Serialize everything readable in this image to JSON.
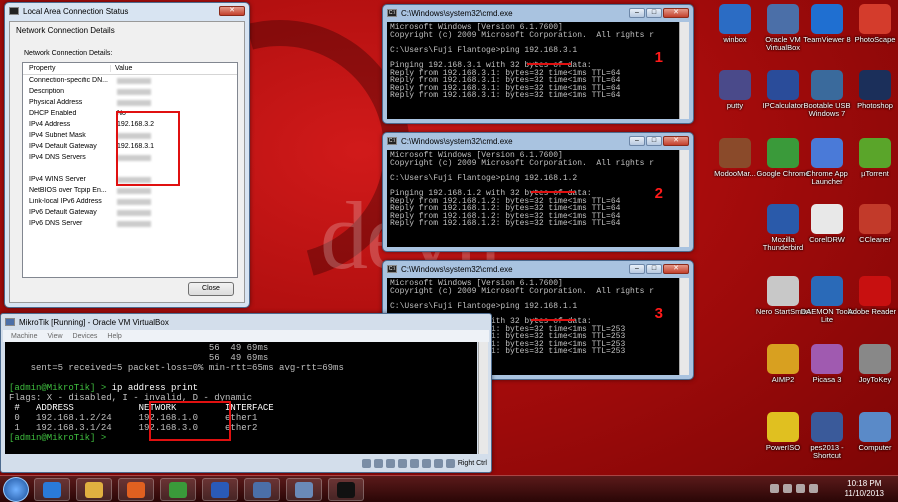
{
  "net_dialog": {
    "title": "Local Area Connection Status",
    "tab": "Network Connection Details",
    "group_label": "Network Connection Details:",
    "col_property": "Property",
    "col_value": "Value",
    "rows": [
      {
        "p": "Connection-specific DN...",
        "v": ""
      },
      {
        "p": "Description",
        "v": ""
      },
      {
        "p": "Physical Address",
        "v": ""
      },
      {
        "p": "DHCP Enabled",
        "v": "No"
      },
      {
        "p": "IPv4 Address",
        "v": "192.168.3.2"
      },
      {
        "p": "IPv4 Subnet Mask",
        "v": ""
      },
      {
        "p": "IPv4 Default Gateway",
        "v": "192.168.3.1"
      },
      {
        "p": "IPv4 DNS Servers",
        "v": ""
      },
      {
        "p": "",
        "v": ""
      },
      {
        "p": "IPv4 WINS Server",
        "v": ""
      },
      {
        "p": "NetBIOS over Tcpip En...",
        "v": ""
      },
      {
        "p": "Link-local IPv6 Address",
        "v": ""
      },
      {
        "p": "IPv6 Default Gateway",
        "v": ""
      },
      {
        "p": "IPv6 DNS Server",
        "v": ""
      }
    ],
    "close_label": "Close"
  },
  "cmd_windows": [
    {
      "title": "C:\\Windows\\system32\\cmd.exe",
      "number": "1",
      "lines": [
        "Microsoft Windows [Version 6.1.7600]",
        "Copyright (c) 2009 Microsoft Corporation.  All rights r",
        "",
        "C:\\Users\\Fuji Flantoge>ping 192.168.3.1",
        "",
        "Pinging 192.168.3.1 with 32 bytes of data:",
        "Reply from 192.168.3.1: bytes=32 time<1ms TTL=64",
        "Reply from 192.168.3.1: bytes=32 time<1ms TTL=64",
        "Reply from 192.168.3.1: bytes=32 time<1ms TTL=64",
        "Reply from 192.168.3.1: bytes=32 time<1ms TTL=64"
      ]
    },
    {
      "title": "C:\\Windows\\system32\\cmd.exe",
      "number": "2",
      "lines": [
        "Microsoft Windows [Version 6.1.7600]",
        "Copyright (c) 2009 Microsoft Corporation.  All rights r",
        "",
        "C:\\Users\\Fuji Flantoge>ping 192.168.1.2",
        "",
        "Pinging 192.168.1.2 with 32 bytes of data:",
        "Reply from 192.168.1.2: bytes=32 time<1ms TTL=64",
        "Reply from 192.168.1.2: bytes=32 time<1ms TTL=64",
        "Reply from 192.168.1.2: bytes=32 time<1ms TTL=64",
        "Reply from 192.168.1.2: bytes=32 time<1ms TTL=64"
      ]
    },
    {
      "title": "C:\\Windows\\system32\\cmd.exe",
      "number": "3",
      "lines": [
        "Microsoft Windows [Version 6.1.7600]",
        "Copyright (c) 2009 Microsoft Corporation.  All rights r",
        "",
        "C:\\Users\\Fuji Flantoge>ping 192.168.1.1",
        "",
        "Pinging 192.168.1.1 with 32 bytes of data:",
        "Reply from 192.168.1.1: bytes=32 time<1ms TTL=253",
        "Reply from 192.168.1.1: bytes=32 time<1ms TTL=253",
        "Reply from 192.168.1.1: bytes=32 time<1ms TTL=253",
        "Reply from 192.168.1.1: bytes=32 time<1ms TTL=253"
      ]
    }
  ],
  "vbox": {
    "title": "MikroTik [Running] - Oracle VM VirtualBox",
    "menu": [
      "Machine",
      "View",
      "Devices",
      "Help"
    ],
    "line1": "                                     56  49 69ms",
    "line2": "                                     56  49 69ms",
    "line3": "    sent=5 received=5 packet-loss=0% min-rtt=65ms avg-rtt=69ms",
    "prompt": "[admin@MikroTik] > ",
    "cmd": "ip address print",
    "flags": "Flags: X - disabled, I - invalid, D - dynamic",
    "header": " #   ADDRESS            NETWORK         INTERFACE",
    "row0": " 0   192.168.1.2/24     192.168.1.0     ether1",
    "row1": " 1   192.168.3.1/24     192.168.3.0     ether2",
    "status_key": "Right Ctrl"
  },
  "desktop_icons": [
    {
      "label": "winbox",
      "color": "#2b6cc4"
    },
    {
      "label": "Oracle VM VirtualBox",
      "color": "#4b6fa8"
    },
    {
      "label": "TeamViewer 8",
      "color": "#1f6fd1"
    },
    {
      "label": "PhotoScape",
      "color": "#d43c2c"
    },
    {
      "label": "putty",
      "color": "#4a4a8a"
    },
    {
      "label": "IPCalculator",
      "color": "#2a4c9a"
    },
    {
      "label": "Bootable USB Windows 7",
      "color": "#3a6a9c"
    },
    {
      "label": "Photoshop",
      "color": "#1b2f5a"
    },
    {
      "label": "ModooMar...",
      "color": "#8a4a2a"
    },
    {
      "label": "Google Chrome",
      "color": "#3a9a3a"
    },
    {
      "label": "Chrome App Launcher",
      "color": "#4a7ad8"
    },
    {
      "label": "µTorrent",
      "color": "#5aa52a"
    },
    {
      "label": "Mozilla Thunderbird",
      "color": "#2a5aaa"
    },
    {
      "label": "CorelDRW",
      "color": "#e8e8e8"
    },
    {
      "label": "CCleaner",
      "color": "#c23a2a"
    },
    {
      "label": "Nero StartSmart",
      "color": "#c8c8c8"
    },
    {
      "label": "DAEMON Tools Lite",
      "color": "#2a6ab8"
    },
    {
      "label": "Adobe Reader 9",
      "color": "#c81010"
    },
    {
      "label": "AIMP2",
      "color": "#d8a020"
    },
    {
      "label": "Picasa 3",
      "color": "#a05ab0"
    },
    {
      "label": "JoyToKey",
      "color": "#888888"
    },
    {
      "label": "PowerISO",
      "color": "#e0c020"
    },
    {
      "label": "pes2013 - Shortcut",
      "color": "#3a5a9a"
    },
    {
      "label": "Computer",
      "color": "#5a8ac8"
    }
  ],
  "taskbar": {
    "time": "10:18 PM",
    "date": "11/10/2013",
    "apps": [
      {
        "name": "ie",
        "color": "#2a7ad8"
      },
      {
        "name": "explorer",
        "color": "#e0b040"
      },
      {
        "name": "media-player",
        "color": "#e06020"
      },
      {
        "name": "chrome",
        "color": "#3a9a3a"
      },
      {
        "name": "word",
        "color": "#2a5ab8"
      },
      {
        "name": "virtualbox",
        "color": "#4b6fa8"
      },
      {
        "name": "network",
        "color": "#6a8ab8"
      },
      {
        "name": "cmd",
        "color": "#111111"
      }
    ]
  }
}
